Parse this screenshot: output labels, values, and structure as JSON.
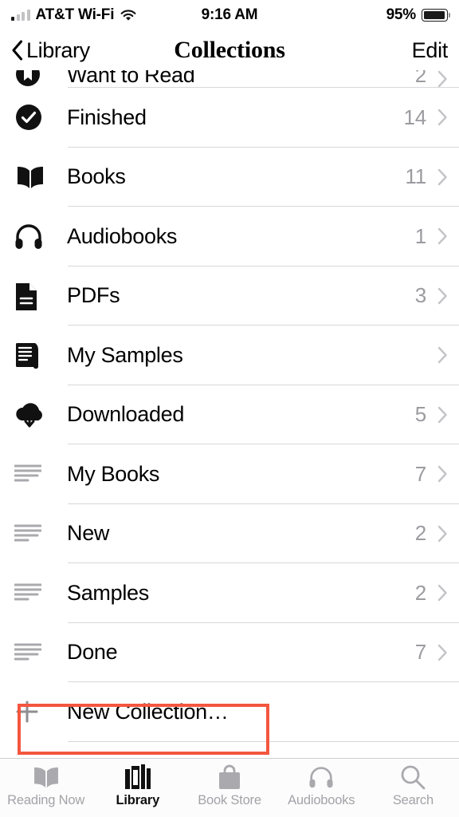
{
  "status_bar": {
    "carrier": "AT&T Wi-Fi",
    "wifi_icon": "wifi-icon",
    "signal_icon": "signal-bars-icon",
    "time": "9:16 AM",
    "battery_percent": "95%",
    "battery_icon": "battery-icon",
    "battery_level": 95
  },
  "nav_bar": {
    "back_label": "Library",
    "back_icon": "chevron-left-icon",
    "title": "Collections",
    "edit_label": "Edit"
  },
  "list": {
    "clipped_top_row": {
      "label": "Want to Read",
      "count": "2",
      "icon": "bookmark-circle-icon"
    },
    "rows": [
      {
        "label": "Finished",
        "count": "14",
        "icon": "checkmark-circle-icon",
        "icon_style": "dark"
      },
      {
        "label": "Books",
        "count": "11",
        "icon": "open-book-icon",
        "icon_style": "dark"
      },
      {
        "label": "Audiobooks",
        "count": "1",
        "icon": "headphones-icon",
        "icon_style": "dark"
      },
      {
        "label": "PDFs",
        "count": "3",
        "icon": "document-icon",
        "icon_style": "dark"
      },
      {
        "label": "My Samples",
        "count": "",
        "icon": "stacked-pages-icon",
        "icon_style": "dark"
      },
      {
        "label": "Downloaded",
        "count": "5",
        "icon": "cloud-download-icon",
        "icon_style": "dark"
      },
      {
        "label": "My Books",
        "count": "7",
        "icon": "list-lines-icon",
        "icon_style": "gray"
      },
      {
        "label": "New",
        "count": "2",
        "icon": "list-lines-icon",
        "icon_style": "gray"
      },
      {
        "label": "Samples",
        "count": "2",
        "icon": "list-lines-icon",
        "icon_style": "gray"
      },
      {
        "label": "Done",
        "count": "7",
        "icon": "list-lines-icon",
        "icon_style": "gray"
      }
    ],
    "new_collection": {
      "label": "New Collection…",
      "icon": "plus-icon"
    },
    "chevron_icon": "chevron-right-icon"
  },
  "annotation": {
    "color": "#f4563f",
    "target": "new-collection-row"
  },
  "tab_bar": {
    "tabs": [
      {
        "label": "Reading Now",
        "icon": "open-book-icon",
        "active": false
      },
      {
        "label": "Library",
        "icon": "bookshelf-icon",
        "active": true
      },
      {
        "label": "Book Store",
        "icon": "shopping-bag-icon",
        "active": false
      },
      {
        "label": "Audiobooks",
        "icon": "headphones-icon",
        "active": false
      },
      {
        "label": "Search",
        "icon": "search-icon",
        "active": false
      }
    ]
  },
  "colors": {
    "accent_red": "#f4563f",
    "gray_text": "#9b9ba0",
    "separator": "#d8d8dc"
  }
}
